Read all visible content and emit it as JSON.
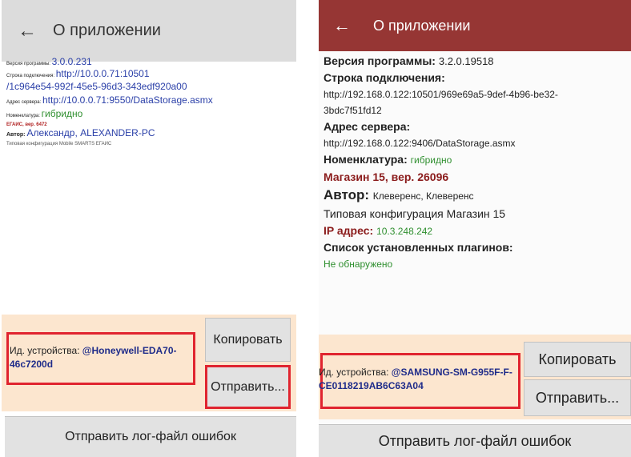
{
  "left": {
    "title": "О приложении",
    "version_label": "Версия программы: ",
    "version_value": "3.0.0.231",
    "conn_label": "Строка подключения: ",
    "conn_value_1": "http://10.0.0.71:10501",
    "conn_value_2": "/1c964e54-992f-45e5-96d3-343edf920a00",
    "server_label": "Адрес сервера: ",
    "server_value": "http://10.0.0.71:9550/DataStorage.asmx",
    "nom_label": "Номенклатура: ",
    "nom_value": "гибридно",
    "egais": "ЕГАИС, вер. 6472",
    "author_label": "Автор: ",
    "author_value": "Александр, ALEXANDER-PC",
    "config": "Типовая конфигурация Mobile SMARTS ЕГАИС",
    "device_label": "Ид. устройства: ",
    "device_id": "@Honeywell-EDA70-46c7200d",
    "copy_button": "Копировать",
    "send_button": "Отправить...",
    "log_button": "Отправить лог-файл ошибок"
  },
  "right": {
    "title": "О приложении",
    "version_label": "Версия программы: ",
    "version_value": "3.2.0.19518",
    "conn_label": "Строка подключения:",
    "conn_value_1": "http://192.168.0.122:10501/969e69a5-9def-4b96-be32-",
    "conn_value_2": "3bdc7f51fd12",
    "server_label": "Адрес сервера:",
    "server_value": "http://192.168.0.122:9406/DataStorage.asmx",
    "nom_label": "Номенклатура: ",
    "nom_value": "гибридно",
    "store": "Магазин 15, вер. 26096",
    "author_label": "Автор: ",
    "author_value": "Клеверенс, Клеверенс",
    "config": "Типовая конфигурация Магазин 15",
    "ip_label": "IP адрес: ",
    "ip_value": "10.3.248.242",
    "plugins_label": "Список установленных плагинов:",
    "plugins_value": "Не обнаружено",
    "device_label": "Ид. устройства: ",
    "device_id": "@SAMSUNG-SM-G955F-F-CE0118219AB6C63A04",
    "copy_button": "Копировать",
    "send_button": "Отправить...",
    "log_button": "Отправить лог-файл ошибок"
  },
  "colors": {
    "left_appbar": "#dcdcdc",
    "right_appbar": "#963634",
    "panel": "#fce6cf",
    "highlight": "#e0242f",
    "link_blue": "#2a3fa8",
    "green": "#2f8f2f",
    "dark_red": "#8b1c1c"
  },
  "icons": {
    "back": "arrow-left"
  }
}
